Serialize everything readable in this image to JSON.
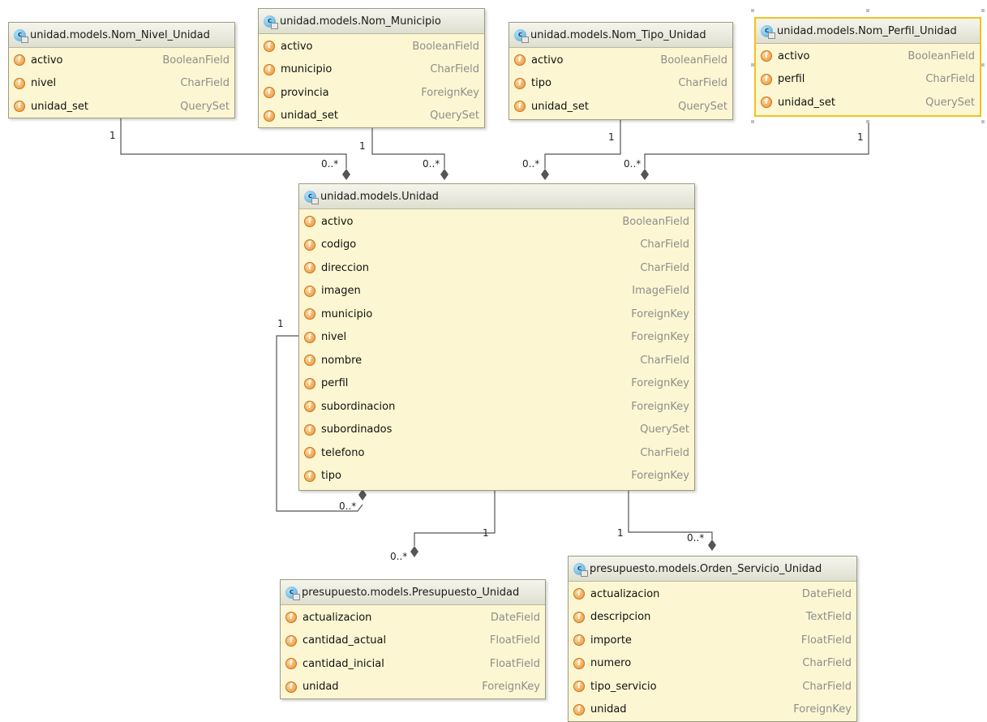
{
  "classes": [
    {
      "id": "nivel",
      "name": "unidad.models.Nom_Nivel_Unidad",
      "fields": [
        {
          "name": "activo",
          "type": "BooleanField"
        },
        {
          "name": "nivel",
          "type": "CharField"
        },
        {
          "name": "unidad_set",
          "type": "QuerySet"
        }
      ]
    },
    {
      "id": "municipio",
      "name": "unidad.models.Nom_Municipio",
      "fields": [
        {
          "name": "activo",
          "type": "BooleanField"
        },
        {
          "name": "municipio",
          "type": "CharField"
        },
        {
          "name": "provincia",
          "type": "ForeignKey"
        },
        {
          "name": "unidad_set",
          "type": "QuerySet"
        }
      ]
    },
    {
      "id": "tipo",
      "name": "unidad.models.Nom_Tipo_Unidad",
      "fields": [
        {
          "name": "activo",
          "type": "BooleanField"
        },
        {
          "name": "tipo",
          "type": "CharField"
        },
        {
          "name": "unidad_set",
          "type": "QuerySet"
        }
      ]
    },
    {
      "id": "perfil",
      "name": "unidad.models.Nom_Perfil_Unidad",
      "fields": [
        {
          "name": "activo",
          "type": "BooleanField"
        },
        {
          "name": "perfil",
          "type": "CharField"
        },
        {
          "name": "unidad_set",
          "type": "QuerySet"
        }
      ]
    },
    {
      "id": "unidad",
      "name": "unidad.models.Unidad",
      "fields": [
        {
          "name": "activo",
          "type": "BooleanField"
        },
        {
          "name": "codigo",
          "type": "CharField"
        },
        {
          "name": "direccion",
          "type": "CharField"
        },
        {
          "name": "imagen",
          "type": "ImageField"
        },
        {
          "name": "municipio",
          "type": "ForeignKey"
        },
        {
          "name": "nivel",
          "type": "ForeignKey"
        },
        {
          "name": "nombre",
          "type": "CharField"
        },
        {
          "name": "perfil",
          "type": "ForeignKey"
        },
        {
          "name": "subordinacion",
          "type": "ForeignKey"
        },
        {
          "name": "subordinados",
          "type": "QuerySet"
        },
        {
          "name": "telefono",
          "type": "CharField"
        },
        {
          "name": "tipo",
          "type": "ForeignKey"
        }
      ]
    },
    {
      "id": "presupuesto",
      "name": "presupuesto.models.Presupuesto_Unidad",
      "fields": [
        {
          "name": "actualizacion",
          "type": "DateField"
        },
        {
          "name": "cantidad_actual",
          "type": "FloatField"
        },
        {
          "name": "cantidad_inicial",
          "type": "FloatField"
        },
        {
          "name": "unidad",
          "type": "ForeignKey"
        }
      ]
    },
    {
      "id": "orden",
      "name": "presupuesto.models.Orden_Servicio_Unidad",
      "fields": [
        {
          "name": "actualizacion",
          "type": "DateField"
        },
        {
          "name": "descripcion",
          "type": "TextField"
        },
        {
          "name": "importe",
          "type": "FloatField"
        },
        {
          "name": "numero",
          "type": "CharField"
        },
        {
          "name": "tipo_servicio",
          "type": "CharField"
        },
        {
          "name": "unidad",
          "type": "ForeignKey"
        }
      ]
    }
  ],
  "selected_class": "perfil",
  "icons": {
    "class": "class-icon",
    "field": "field-icon"
  },
  "icon_letters": {
    "class": "c",
    "field": "f"
  },
  "colors": {
    "box_fill": "#fcf7d2",
    "selection": "#f3c21c",
    "line": "#555555",
    "field_type": "#8d8d8d"
  },
  "multiplicities": {
    "one": "1",
    "many": "0..*"
  }
}
